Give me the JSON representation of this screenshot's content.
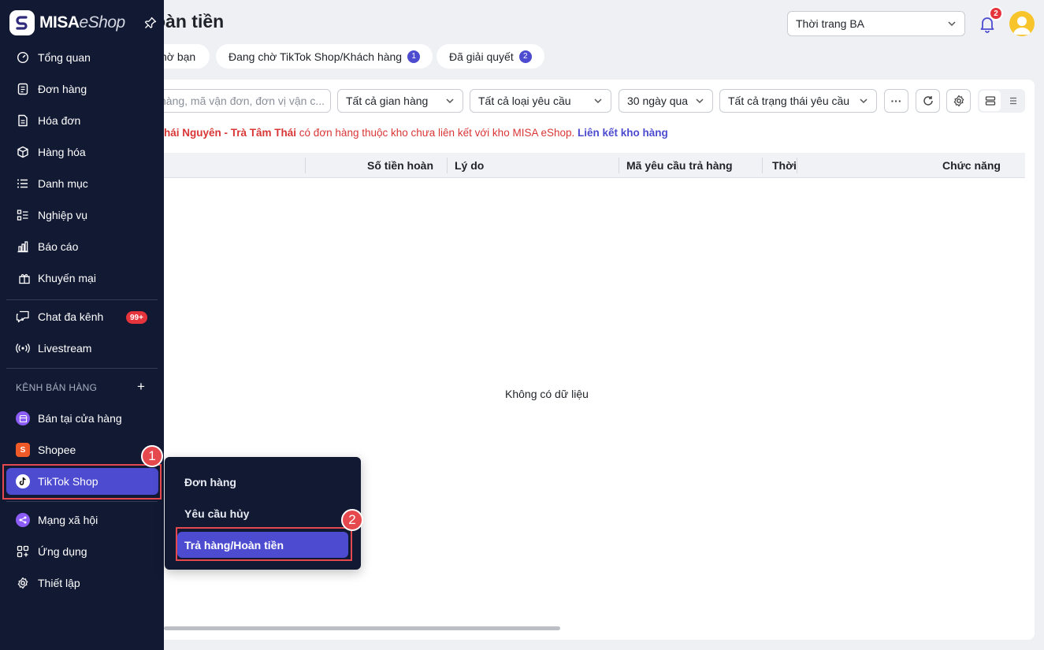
{
  "app": {
    "logo_brand": "MISA",
    "logo_product": "eShop"
  },
  "header": {
    "title": "Trả hàng/Hoàn tiền",
    "title_visible": "oàn tiền",
    "store_select": "Thời trang BA",
    "notification_count": "2"
  },
  "tabs": [
    {
      "label": "Chờ bạn",
      "visible_label": "hờ bạn",
      "count": ""
    },
    {
      "label": "Đang chờ TikTok Shop/Khách hàng",
      "count": "1"
    },
    {
      "label": "Đã giải quyết",
      "count": "2"
    }
  ],
  "toolbar": {
    "search_placeholder": "hàng, mã vận đơn, đơn vị vận c...",
    "filter_store": "Tất cả gian hàng",
    "filter_request_type": "Tất cả loại yêu cầu",
    "filter_period": "30 ngày qua",
    "filter_status": "Tất cả trạng thái yêu cầu",
    "more_label": "···"
  },
  "warning": {
    "store_name": "hái Nguyên - Trà Tâm Thái",
    "message": " có đơn hàng thuộc kho chưa liên kết với kho MISA eShop. ",
    "link": "Liên kết kho hàng"
  },
  "table": {
    "columns": [
      "Số tiền hoàn",
      "Lý do",
      "Mã yêu cầu trả hàng",
      "Thời",
      "Chức năng"
    ],
    "empty_text": "Không có dữ liệu"
  },
  "sidebar": {
    "items": [
      {
        "label": "Tổng quan",
        "icon": "dashboard-icon"
      },
      {
        "label": "Đơn hàng",
        "icon": "order-icon"
      },
      {
        "label": "Hóa đơn",
        "icon": "invoice-icon"
      },
      {
        "label": "Hàng hóa",
        "icon": "box-icon"
      },
      {
        "label": "Danh mục",
        "icon": "list-icon"
      },
      {
        "label": "Nghiệp vụ",
        "icon": "tasks-icon"
      },
      {
        "label": "Báo cáo",
        "icon": "chart-icon"
      },
      {
        "label": "Khuyến mại",
        "icon": "gift-icon"
      }
    ],
    "chat": {
      "label": "Chat đa kênh",
      "badge": "99+"
    },
    "livestream": {
      "label": "Livestream"
    },
    "section_title": "KÊNH BÁN HÀNG",
    "channels": [
      {
        "label": "Bán tại cửa hàng",
        "color": "#8b5cf6"
      },
      {
        "label": "Shopee",
        "color": "#f05a28"
      },
      {
        "label": "TikTok Shop",
        "color": "#000000"
      }
    ],
    "bottom": [
      {
        "label": "Mạng xã hội"
      },
      {
        "label": "Ứng dụng"
      },
      {
        "label": "Thiết lập"
      }
    ]
  },
  "flyout": {
    "items": [
      "Đơn hàng",
      "Yêu cầu hủy",
      "Trả hàng/Hoàn tiền"
    ]
  },
  "annotations": {
    "marker_1": "1",
    "marker_2": "2"
  },
  "colors": {
    "accent": "#4d4bd0",
    "sidebar_bg": "#121933",
    "danger": "#e5343b",
    "highlight": "#e5484d"
  }
}
